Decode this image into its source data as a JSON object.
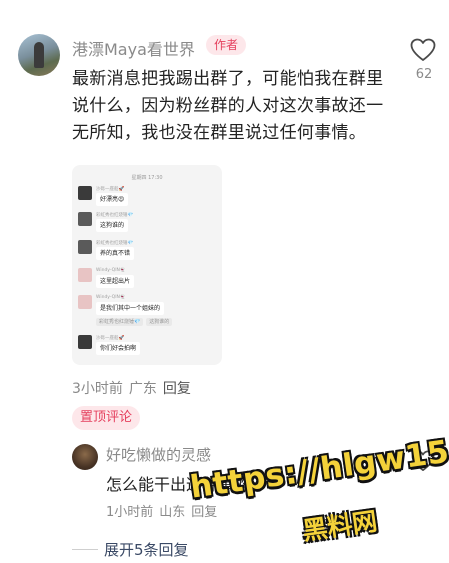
{
  "main_comment": {
    "author": "港漂Maya看世界",
    "badge": "作者",
    "text": "最新消息把我踢出群了，可能怕我在群里说什么，因为粉丝群的人对这次事故还一无所知，我也没在群里说过任何事情。",
    "likes": "62",
    "time": "3小时前",
    "location": "广东",
    "reply_label": "回复",
    "pinned_tag": "置顶评论",
    "attachment": {
      "time": "星期四 17:30",
      "messages": [
        {
          "name": "沙砾一座船🚀",
          "text": "好漂亮😍",
          "avatar_color": "#3a3a3a"
        },
        {
          "name": "彩虹秀也红烧锤💎",
          "text": "这狗谁的",
          "avatar_color": "#5a5a5a"
        },
        {
          "name": "彩虹秀也红烧锤💎",
          "text": "养的真不错",
          "avatar_color": "#5a5a5a"
        },
        {
          "name": "Windy-QIN👻",
          "text": "这里超出片",
          "avatar_color": "#e8c4c4"
        },
        {
          "name": "Windy-QIN👻",
          "text": "是我们其中一个姐妹的",
          "avatar_color": "#e8c4c4"
        },
        {
          "name": "沙砾一座船🚀",
          "text": "你们好会拍啊",
          "avatar_color": "#3a3a3a"
        }
      ],
      "system_1": "彩虹秀也红烧锤💎",
      "system_2": "这狗谁的"
    }
  },
  "reply": {
    "author": "好吃懒做的灵感",
    "text": "怎么能干出这种事的",
    "time": "1小时前",
    "location": "山东",
    "reply_label": "回复"
  },
  "expand_label": "展开5条回复",
  "watermark": {
    "line1": "https://hlgw15.com",
    "line2": "黑料网"
  }
}
